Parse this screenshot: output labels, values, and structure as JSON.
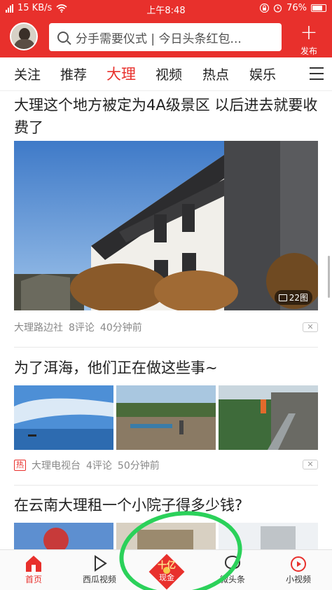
{
  "status_bar": {
    "network": "15 KB/s",
    "time": "上午8:48",
    "battery": "76%"
  },
  "header": {
    "search_placeholder": "分手需要仪式 | 今日头条红包...",
    "publish_label": "发布"
  },
  "tabs": [
    {
      "label": "关注",
      "active": false
    },
    {
      "label": "推荐",
      "active": false
    },
    {
      "label": "大理",
      "active": true
    },
    {
      "label": "视频",
      "active": false
    },
    {
      "label": "热点",
      "active": false
    },
    {
      "label": "娱乐",
      "active": false
    }
  ],
  "feed": [
    {
      "title": "大理这个地方被定为4A级景区 以后进去就要收费了",
      "source": "大理路边社",
      "comments": "8评论",
      "time": "40分钟前",
      "image_count": "22图"
    },
    {
      "title": "为了洱海，他们正在做这些事~",
      "badge": "热",
      "source": "大理电视台",
      "comments": "4评论",
      "time": "50分钟前"
    },
    {
      "title": "在云南大理租一个小院子得多少钱?"
    }
  ],
  "bottom_nav": [
    {
      "label": "首页",
      "icon": "home-icon",
      "active": true
    },
    {
      "label": "西瓜视频",
      "icon": "play-icon",
      "active": false
    },
    {
      "label": "现金",
      "top": "十亿",
      "icon": "cash-envelope-icon",
      "active": false
    },
    {
      "label": "微头条",
      "icon": "chat-bubble-icon",
      "active": false
    },
    {
      "label": "小视频",
      "icon": "small-video-icon",
      "active": false
    }
  ],
  "colors": {
    "brand_red": "#e8302c",
    "highlight_green": "#2bd15a"
  }
}
